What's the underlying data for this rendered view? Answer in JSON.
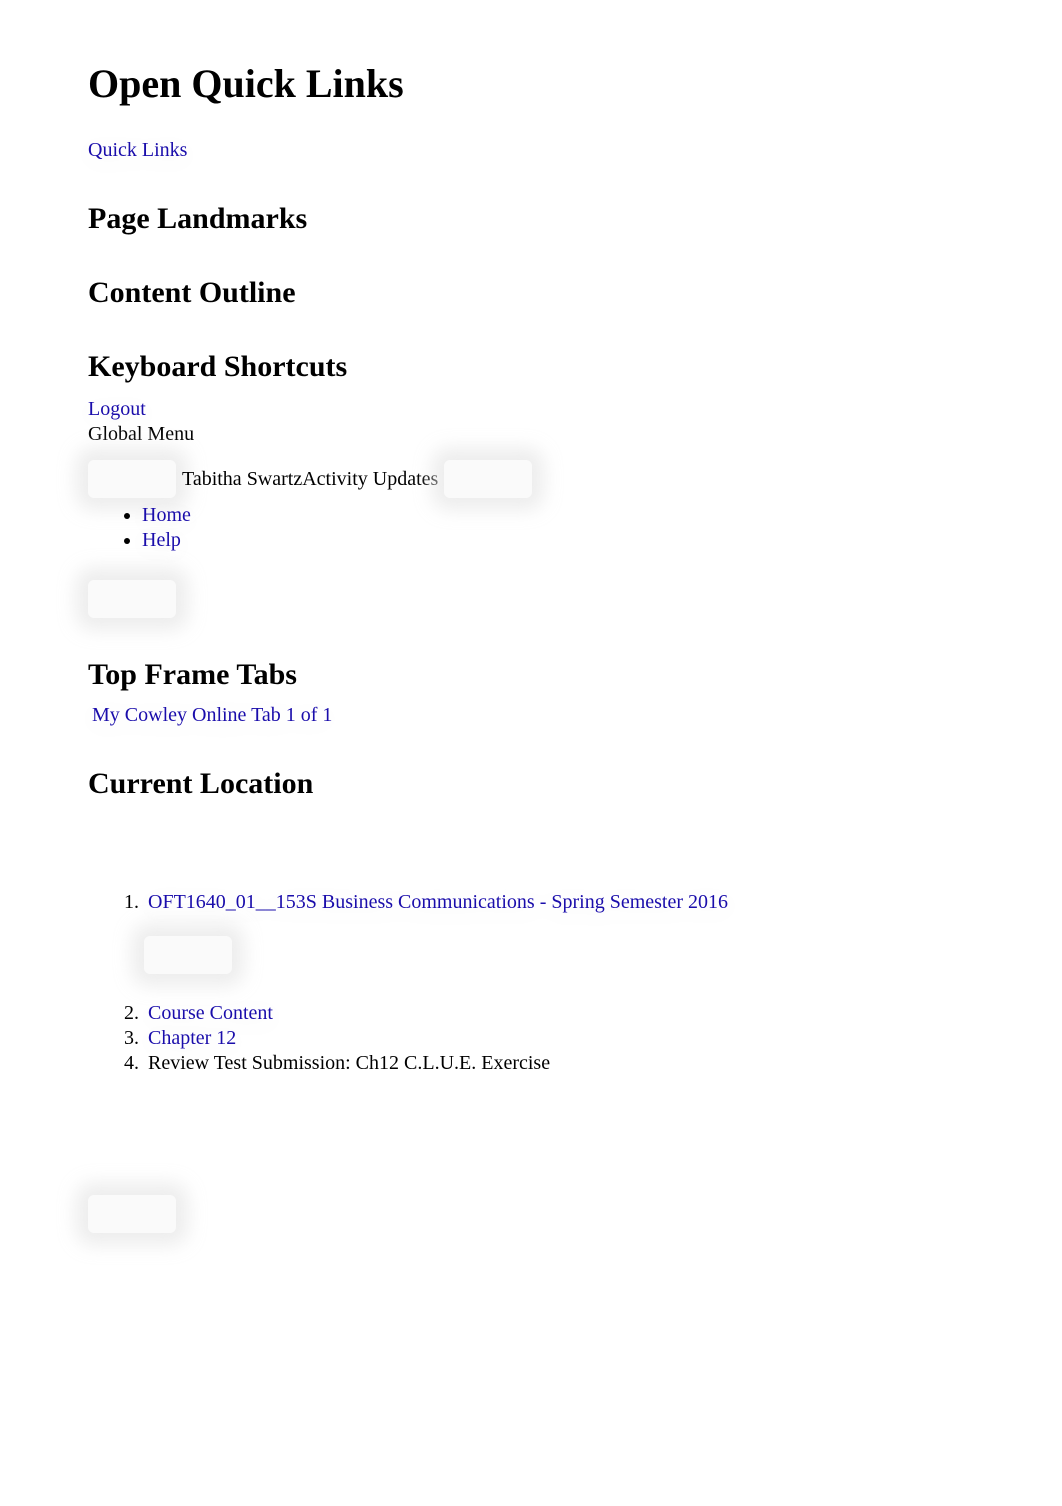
{
  "page_title": "Open Quick Links",
  "quick_links_label": "Quick Links",
  "headings": {
    "page_landmarks": "Page Landmarks",
    "content_outline": "Content Outline",
    "keyboard_shortcuts": "Keyboard Shortcuts",
    "top_frame_tabs": "Top Frame Tabs",
    "current_location": "Current Location"
  },
  "logout_label": "Logout",
  "global_menu_label": "Global Menu",
  "user_name": "Tabitha Swartz",
  "activity_updates_label": "Activity Updates",
  "nav": {
    "home": "Home",
    "help": "Help"
  },
  "tab_label": "My Cowley Online Tab 1 of 1",
  "breadcrumb": {
    "item1": "OFT1640_01__153S Business Communications - Spring Semester 2016",
    "item2": "Course Content",
    "item3": "Chapter 12",
    "item4": "Review Test Submission: Ch12 C.L.U.E. Exercise"
  }
}
